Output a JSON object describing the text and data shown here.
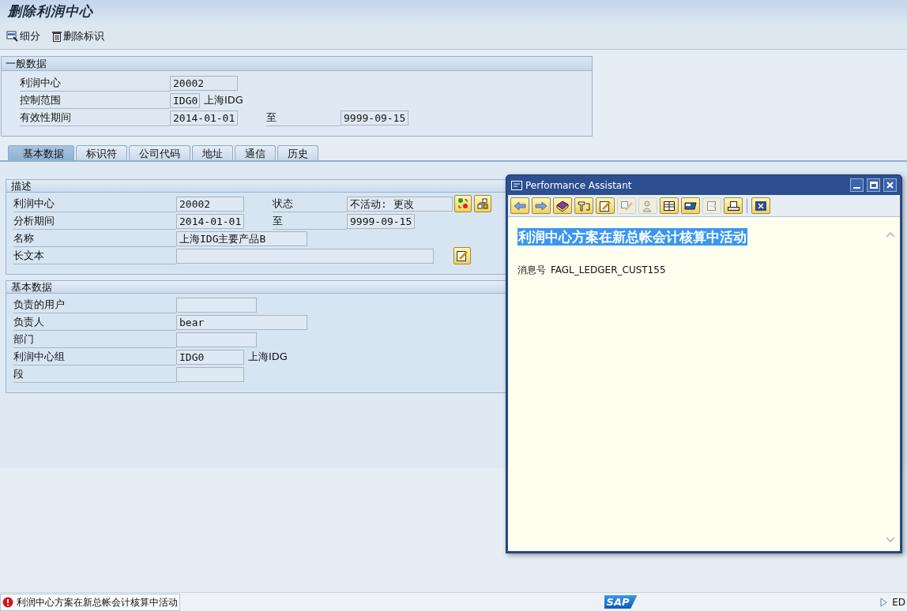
{
  "title": "删除利润中心",
  "toolbar": [
    {
      "kind": "detail",
      "label": "细分"
    },
    {
      "kind": "delete",
      "label": "删除标识"
    }
  ],
  "general": {
    "title": "一般数据",
    "rows": [
      {
        "label": "利润中心",
        "value": "20002"
      },
      {
        "label": "控制范围",
        "value": "IDG0",
        "note": "上海IDG"
      },
      {
        "label": "有效性期间",
        "value": "2014-01-01",
        "side_label": "至",
        "side_value": "9999-09-15"
      }
    ]
  },
  "tabs": [
    {
      "label": "基本数据",
      "selected": true
    },
    {
      "label": "标识符",
      "selected": false
    },
    {
      "label": "公司代码",
      "selected": false
    },
    {
      "label": "地址",
      "selected": false
    },
    {
      "label": "通信",
      "selected": false
    },
    {
      "label": "历史",
      "selected": false
    }
  ],
  "sections": [
    {
      "title": "描述",
      "rows": [
        {
          "label": "利润中心",
          "value": "20002",
          "side_label": "状态",
          "side_value": "不活动: 更改",
          "buttons": [
            {
              "kind": "status"
            },
            {
              "kind": "hierarchy"
            }
          ]
        },
        {
          "label": "分析期间",
          "value": "2014-01-01",
          "side_label": "至",
          "side_value": "9999-09-15"
        },
        {
          "label": "名称",
          "value": "上海IDG主要产品B"
        },
        {
          "label": "长文本",
          "value": "",
          "buttons": [
            {
              "kind": "edit"
            }
          ]
        }
      ]
    },
    {
      "title": "基本数据",
      "rows": [
        {
          "label": "负责的用户",
          "value": ""
        },
        {
          "label": "负责人",
          "value": "bear"
        },
        {
          "label": "部门",
          "value": ""
        },
        {
          "label": "利润中心组",
          "value": "IDG0",
          "note": "上海IDG"
        },
        {
          "label": "段",
          "value": ""
        }
      ]
    }
  ],
  "assistant": {
    "title": "Performance Assistant",
    "tools": [
      {
        "kind": "back",
        "disabled": false
      },
      {
        "kind": "forward",
        "disabled": false
      },
      {
        "kind": "book",
        "disabled": false
      },
      {
        "kind": "technical",
        "disabled": false
      },
      {
        "kind": "edit",
        "disabled": false
      },
      {
        "kind": "annotate",
        "disabled": true
      },
      {
        "kind": "person",
        "disabled": true
      },
      {
        "kind": "table",
        "disabled": false
      },
      {
        "kind": "folder",
        "disabled": false
      },
      {
        "kind": "export",
        "disabled": true
      },
      {
        "kind": "print",
        "disabled": false
      },
      {
        "kind": "close",
        "disabled": false
      }
    ],
    "heading": "利润中心方案在新总帐会计核算中活动",
    "highlighted": true,
    "message_label": "消息号",
    "message_id": "FAGL_LEDGER_CUST155"
  },
  "status": {
    "kind": "error",
    "message": "利润中心方案在新总帐会计核算中活动",
    "logo": "SAP",
    "right": "ED"
  }
}
